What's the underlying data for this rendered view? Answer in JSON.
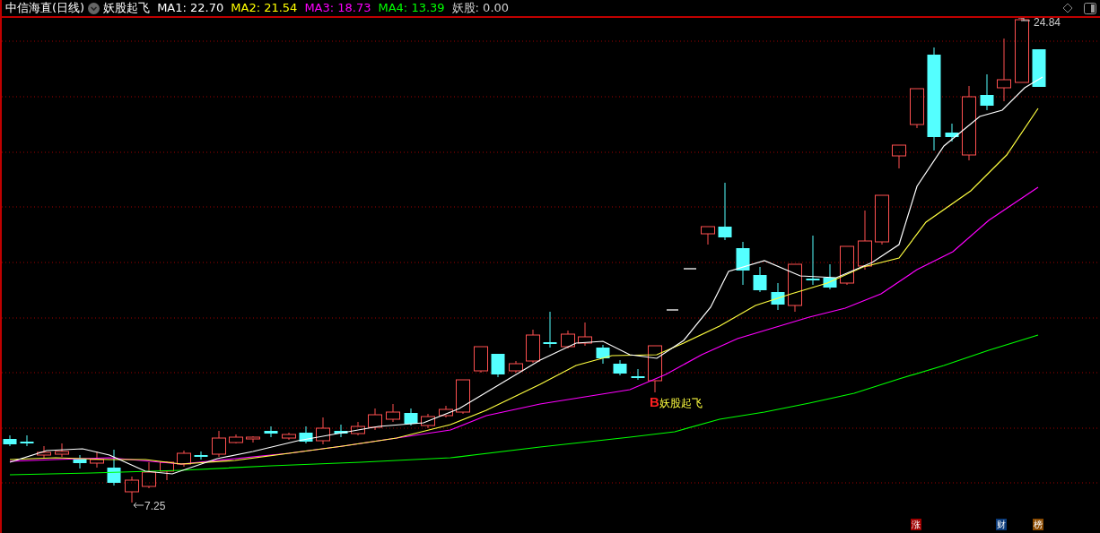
{
  "header": {
    "title": "中信海直(日线)",
    "indicator_name": "妖股起飞",
    "values": [
      {
        "label": "MA1: 22.70",
        "color": "#ffffff"
      },
      {
        "label": "MA2: 21.54",
        "color": "#ffff00"
      },
      {
        "label": "MA3: 18.73",
        "color": "#ff00ff"
      },
      {
        "label": "MA4: 13.39",
        "color": "#00ff00"
      },
      {
        "label": "妖股: 0.00",
        "color": "#d0d0d0"
      }
    ]
  },
  "chart": {
    "high_label": "24.84",
    "low_label": "7.25",
    "signal": {
      "letter": "B",
      "text": "妖股起飞"
    }
  },
  "footer_badges": [
    {
      "text": "涨",
      "color": "#a00000"
    },
    {
      "text": "财",
      "color": "#0a3a7a"
    },
    {
      "text": "榜",
      "color": "#8a4a00"
    }
  ]
}
